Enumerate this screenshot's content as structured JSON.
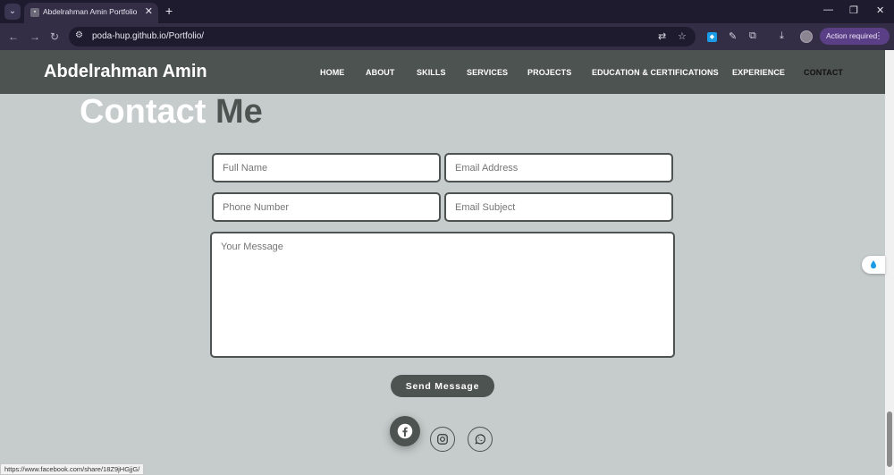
{
  "browser": {
    "tab_title": "Abdelrahman Amin Portfolio",
    "url": "poda-hup.github.io/Portfolio/",
    "action_required": "Action required",
    "status_url": "https://www.facebook.com/share/18Z9jHGjjG/"
  },
  "header": {
    "brand": "Abdelrahman Amin",
    "menu": [
      "HOME",
      "ABOUT",
      "SKILLS",
      "SERVICES",
      "PROJECTS",
      "EDUCATION & CERTIFICATIONS",
      "EXPERIENCE",
      "CONTACT"
    ],
    "active_item": "CONTACT"
  },
  "contact": {
    "heading_part1": "Contact",
    "heading_part2": "Me",
    "placeholders": {
      "full_name": "Full Name",
      "email": "Email Address",
      "phone": "Phone Number",
      "subject": "Email Subject",
      "message": "Your Message"
    },
    "send_label": "Send Message"
  },
  "social": [
    "facebook-icon",
    "instagram-icon",
    "whatsapp-icon"
  ],
  "colors": {
    "background": "#c5cccb",
    "header": "#4d5350",
    "accent": "#4d5350",
    "heading_light": "#ffffff"
  }
}
